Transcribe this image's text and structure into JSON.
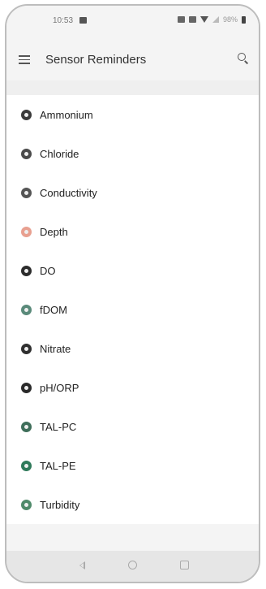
{
  "status_bar": {
    "time": "10:53",
    "battery": "98%"
  },
  "app_bar": {
    "title": "Sensor Reminders",
    "menu_icon": "hamburger-menu-icon",
    "search_icon": "search-icon"
  },
  "sensors": [
    {
      "label": "Ammonium",
      "icon": "ammonium-sensor-icon",
      "color": "#3a3a3a"
    },
    {
      "label": "Chloride",
      "icon": "chloride-sensor-icon",
      "color": "#4a4a4a"
    },
    {
      "label": "Conductivity",
      "icon": "conductivity-sensor-icon",
      "color": "#555555"
    },
    {
      "label": "Depth",
      "icon": "depth-sensor-icon",
      "color": "#e8a090"
    },
    {
      "label": "DO",
      "icon": "do-sensor-icon",
      "color": "#2c2c2c"
    },
    {
      "label": "fDOM",
      "icon": "fdom-sensor-icon",
      "color": "#5a8a7a"
    },
    {
      "label": "Nitrate",
      "icon": "nitrate-sensor-icon",
      "color": "#2f2f2f"
    },
    {
      "label": "pH/ORP",
      "icon": "ph-orp-sensor-icon",
      "color": "#2a2a2a"
    },
    {
      "label": "TAL-PC",
      "icon": "tal-pc-sensor-icon",
      "color": "#3f6e5a"
    },
    {
      "label": "TAL-PE",
      "icon": "tal-pe-sensor-icon",
      "color": "#2f7a5a"
    },
    {
      "label": "Turbidity",
      "icon": "turbidity-sensor-icon",
      "color": "#4f8a6a"
    }
  ],
  "nav_bar": {
    "back_icon": "back-triangle-icon",
    "home_icon": "home-circle-icon",
    "recents_icon": "recents-square-icon"
  }
}
